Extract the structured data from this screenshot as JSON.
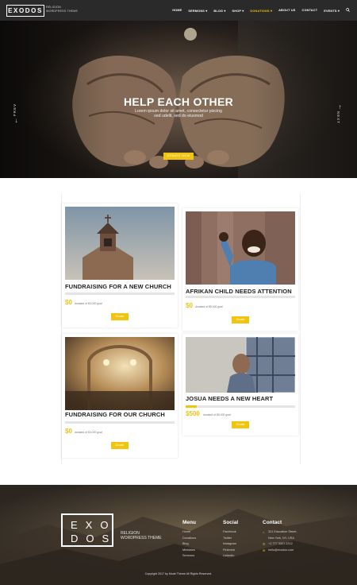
{
  "header": {
    "logo": "EXODOS",
    "tagline_line1": "RELIGION",
    "tagline_line2": "WORDPRESS THEME",
    "nav": [
      {
        "label": "HOME"
      },
      {
        "label": "SERMONS",
        "dropdown": true
      },
      {
        "label": "BLOG",
        "dropdown": true
      },
      {
        "label": "SHOP",
        "dropdown": true
      },
      {
        "label": "DONATIONS",
        "dropdown": true,
        "active": true
      },
      {
        "label": "ABOUT US"
      },
      {
        "label": "CONTACT"
      },
      {
        "label": "EVENTS",
        "dropdown": true
      }
    ],
    "search_icon": "search-icon"
  },
  "hero": {
    "title": "HELP EACH OTHER",
    "text_line1": "Lorem ipsum dolor sit amet, consectetur piscing",
    "text_line2": "sed udelit, sed do eiusmod",
    "button": "DONATE NOW",
    "prev": "PREV",
    "next": "NEXT"
  },
  "cards": [
    {
      "title": "FUNDRAISING FOR A NEW CHURCH",
      "raised": "$0",
      "goal": "donated of $3.000 goal",
      "button": "Donate",
      "progress": 0
    },
    {
      "title": "AFRIKAN CHILD NEEDS ATTENTION",
      "raised": "$0",
      "goal": "donated of $5.000 goal",
      "button": "Donate",
      "progress": 0
    },
    {
      "title": "FUNDRAISING FOR OUR CHURCH",
      "raised": "$0",
      "goal": "donated of $3.000 goal",
      "button": "Donate",
      "progress": 0
    },
    {
      "title": "JOSUA NEEDS A NEW HEART",
      "raised": "$500",
      "goal": "donated of $5.000 goal",
      "button": "Donate",
      "progress": 0.1
    }
  ],
  "footer": {
    "logo_line1": "EXO",
    "logo_line2": "DOS",
    "tag_line1": "RELIGION",
    "tag_line2": "WORDPRESS THEME",
    "menu": {
      "heading": "Menu",
      "items": [
        "Home",
        "Donations",
        "Blog",
        "Ministries",
        "Sermons"
      ]
    },
    "social": {
      "heading": "Social",
      "items": [
        "Facebook",
        "Twitter",
        "Instagram",
        "Pinterest",
        "LinkedIn"
      ]
    },
    "contact": {
      "heading": "Contact",
      "items": [
        "321 Education Street,",
        "New York, NY, USA",
        "+1 777 3321 2212",
        "hello@exodos.com"
      ]
    },
    "copyright": "Copyright 2017 by Mode Theme All Rights Reserved."
  },
  "colors": {
    "accent": "#f1c40f",
    "header_bg": "#2a2a2a"
  }
}
